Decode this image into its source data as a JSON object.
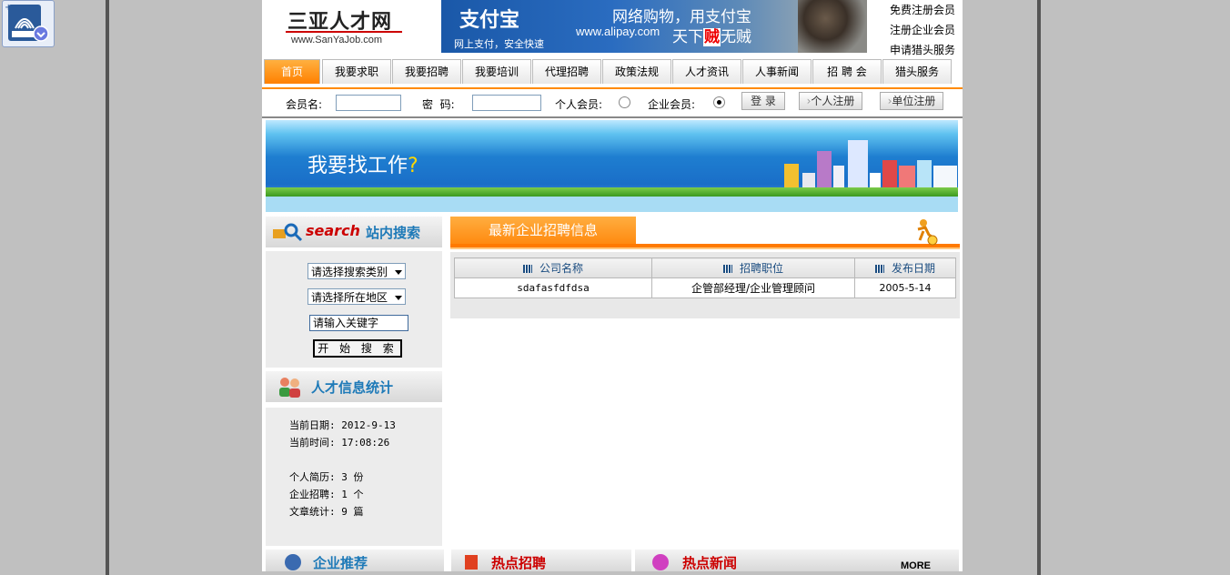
{
  "logo": {
    "cn": "三亚人才网",
    "en": "www.SanYaJob.com"
  },
  "ad": {
    "brand": "支付宝",
    "brand_sub": "网上支付，安全快速",
    "slogan": "网络购物，用支付宝",
    "url": "www.alipay.com",
    "slogan2_a": "天下",
    "slogan2_b": "贼",
    "slogan2_c": "无贼"
  },
  "toplinks": [
    "免费注册会员",
    "注册企业会员",
    "申请猎头服务"
  ],
  "nav": [
    "首页",
    "我要求职",
    "我要招聘",
    "我要培训",
    "代理招聘",
    "政策法规",
    "人才资讯",
    "人事新闻",
    "招 聘 会",
    "猎头服务"
  ],
  "login": {
    "user_label": "会员名:",
    "pwd_label": "密  码:",
    "personal_label": "个人会员:",
    "company_label": "企业会员:",
    "login_btn": "登 录",
    "personal_reg": "个人注册",
    "company_reg": "单位注册"
  },
  "banner": {
    "text": "我要找工作",
    "q": "?"
  },
  "search": {
    "head_en": "search",
    "head_cn": "站内搜索",
    "category": "请选择搜索类别",
    "region": "请选择所在地区",
    "keyword": "请输入关键字",
    "button": "开 始 搜 索"
  },
  "stats": {
    "head": "人才信息统计",
    "date": "当前日期: 2012-9-13",
    "time": "当前时间: 17:08:26",
    "resumes": "个人简历: 3 份",
    "jobs": "企业招聘: 1 个",
    "articles": "文章统计: 9 篇"
  },
  "recruit": {
    "head": "最新企业招聘信息",
    "columns": [
      "公司名称",
      "招聘职位",
      "发布日期"
    ],
    "rows": [
      [
        "sdafasfdfdsa",
        "企管部经理/企业管理顾问",
        "2005-5-14"
      ]
    ]
  },
  "bottom": {
    "company": "企业推荐",
    "hot_jobs": "热点招聘",
    "hot_news": "热点新闻",
    "more": "MORE"
  }
}
